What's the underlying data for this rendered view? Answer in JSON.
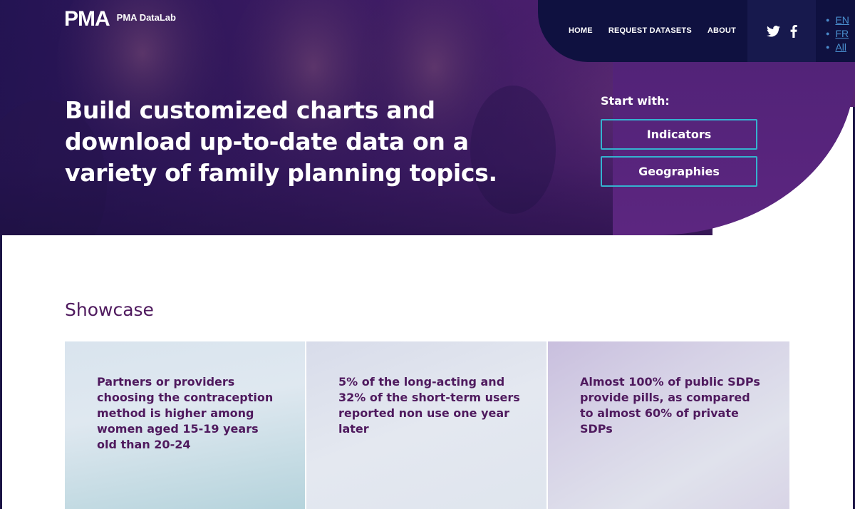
{
  "brand": {
    "logo_mark": "PMA",
    "name": "PMA DataLab"
  },
  "nav": {
    "items": [
      "HOME",
      "REQUEST DATASETS",
      "ABOUT"
    ],
    "social": [
      "twitter-icon",
      "facebook-icon"
    ],
    "languages": [
      "EN",
      "FR",
      "All"
    ]
  },
  "hero": {
    "title": "Build customized charts and download up-to-date data on a variety of family planning topics.",
    "start_with": "Start with:",
    "buttons": [
      "Indicators",
      "Geographies"
    ]
  },
  "showcase": {
    "title": "Showcase",
    "cards": [
      "Partners or providers choosing the contraception method is higher among women aged 15-19 years old than 20-24",
      "5% of the long-acting and 32% of the short-term users reported non use one year later",
      "Almost 100% of public SDPs provide pills, as compared to almost 60% of private SDPs"
    ]
  },
  "colors": {
    "nav_bg": "#0f1140",
    "accent_border": "#34b3cf",
    "heading": "#4f1a5e",
    "link": "#4a90d0"
  }
}
